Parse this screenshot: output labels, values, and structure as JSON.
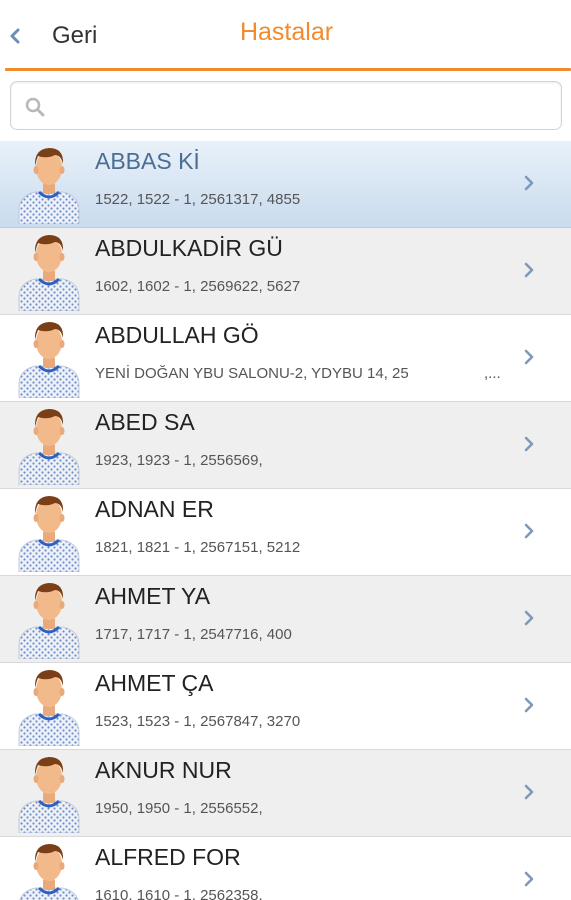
{
  "header": {
    "back_label": "Geri",
    "title": "Hastalar"
  },
  "search": {
    "placeholder": "",
    "value": ""
  },
  "colors": {
    "accent": "#f28a2e",
    "selected_row": "#d6e4f3",
    "alt_row": "#efefef"
  },
  "icons": {
    "back": "chevron-left-icon",
    "search": "search-icon",
    "row_disclosure": "chevron-right-icon",
    "avatar": "patient-avatar-icon"
  },
  "patients": [
    {
      "name": "ABBAS Kİ",
      "detail": "1522, 1522 - 1, 2561317, 4855",
      "detail_extra": ""
    },
    {
      "name": "ABDULKADİR GÜ",
      "detail": "1602, 1602 - 1, 2569622, 5627",
      "detail_extra": ""
    },
    {
      "name": "ABDULLAH GÖ",
      "detail": "YENİ DOĞAN YBU SALONU-2, YDYBU 14, 25",
      "detail_extra": ",..."
    },
    {
      "name": "ABED SA",
      "detail": "1923, 1923 - 1, 2556569,",
      "detail_extra": ""
    },
    {
      "name": "ADNAN ER",
      "detail": "1821, 1821 - 1, 2567151, 5212",
      "detail_extra": ""
    },
    {
      "name": "AHMET YA",
      "detail": "1717, 1717 - 1, 2547716, 400",
      "detail_extra": ""
    },
    {
      "name": "AHMET ÇA",
      "detail": "1523, 1523 - 1, 2567847, 3270",
      "detail_extra": ""
    },
    {
      "name": "AKNUR NUR",
      "detail": "1950, 1950 - 1, 2556552,",
      "detail_extra": ""
    },
    {
      "name": "ALFRED FOR",
      "detail": "1610, 1610 - 1, 2562358,",
      "detail_extra": ""
    }
  ]
}
